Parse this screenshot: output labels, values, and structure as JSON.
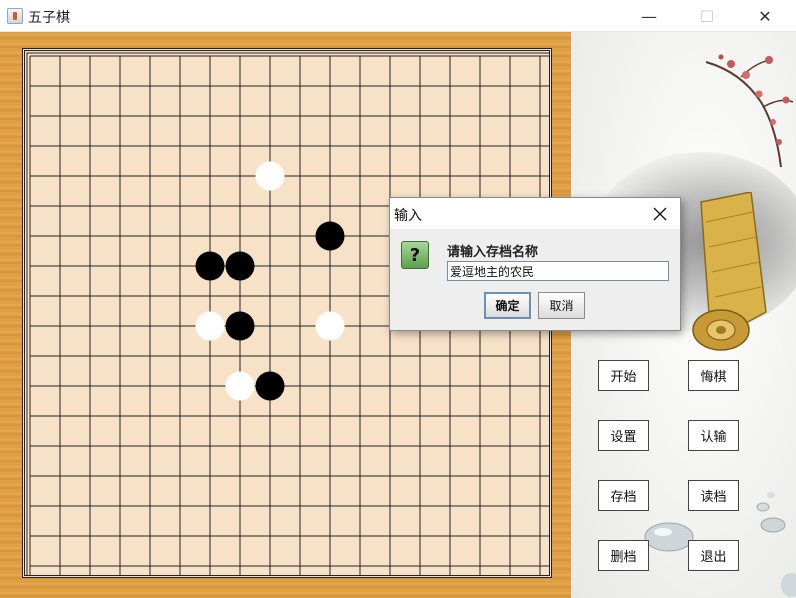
{
  "window": {
    "title": "五子棋",
    "minimize_glyph": "—",
    "maximize_glyph": "☐",
    "close_glyph": "✕"
  },
  "board": {
    "grid_lines": 19,
    "stones": [
      {
        "color": "white",
        "col": 8,
        "row": 4
      },
      {
        "color": "black",
        "col": 10,
        "row": 6
      },
      {
        "color": "black",
        "col": 6,
        "row": 7
      },
      {
        "color": "black",
        "col": 7,
        "row": 7
      },
      {
        "color": "white",
        "col": 6,
        "row": 9
      },
      {
        "color": "black",
        "col": 7,
        "row": 9
      },
      {
        "color": "white",
        "col": 10,
        "row": 9
      },
      {
        "color": "white",
        "col": 7,
        "row": 11
      },
      {
        "color": "black",
        "col": 8,
        "row": 11
      }
    ]
  },
  "side_buttons": {
    "start": "开始",
    "undo": "悔棋",
    "settings": "设置",
    "resign": "认输",
    "save": "存档",
    "load": "读档",
    "delete": "删档",
    "exit": "退出"
  },
  "dialog": {
    "title": "输入",
    "close_glyph": "✕",
    "icon_glyph": "?",
    "prompt": "请输入存档名称",
    "input_value": "爱逗地主的农民",
    "ok_label": "确定",
    "cancel_label": "取消"
  },
  "colors": {
    "board_surface": "#f7e2c8",
    "wood": "#dc9a3f",
    "grid_line": "#222222",
    "black_stone": "#000000",
    "white_stone": "#ffffff"
  }
}
